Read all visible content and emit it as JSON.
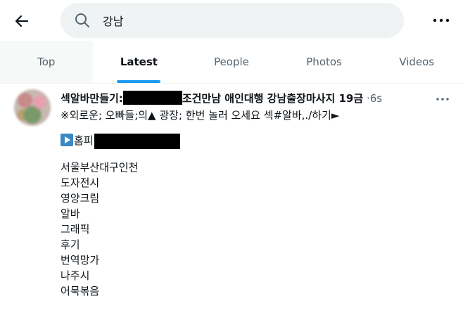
{
  "search": {
    "value": "강남"
  },
  "tabs": [
    {
      "label": "Top"
    },
    {
      "label": "Latest"
    },
    {
      "label": "People"
    },
    {
      "label": "Photos"
    },
    {
      "label": "Videos"
    }
  ],
  "active_tab": "Latest",
  "post": {
    "display_name_start": "섹알바만들기:",
    "display_name_end": "조건만남 애인대행 강남출장마사지 19금",
    "separator": "·",
    "time": "6s",
    "line1": "※외로운; 오빠들;의▲ 광장; 한번 놀러 오세요 섹#알바,./하기►",
    "link_prefix": "홈피",
    "lines": [
      "서울부산대구인천",
      "도자전시",
      "영양크림",
      "알바",
      "그래픽",
      "후기",
      "번역망가",
      "나주시",
      "어묵볶음"
    ]
  },
  "colors": {
    "accent": "#1d9bf0",
    "muted": "#536471",
    "text": "#0f1419",
    "search_bg": "#eff3f4"
  }
}
